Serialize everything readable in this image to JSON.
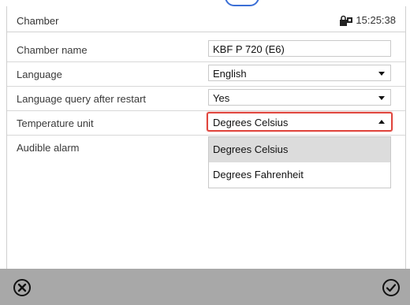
{
  "header": {
    "title": "Chamber",
    "time": "15:25:38",
    "lock_icon": "lock-icon"
  },
  "settings": [
    {
      "label": "Chamber name",
      "value": "KBF P 720 (E6)",
      "type": "text"
    },
    {
      "label": "Language",
      "value": "English",
      "type": "select"
    },
    {
      "label": "Language query after restart",
      "value": "Yes",
      "type": "select"
    },
    {
      "label": "Temperature unit",
      "value": "Degrees Celsius",
      "type": "select-open"
    },
    {
      "label": "Audible alarm",
      "value": "",
      "type": "none"
    }
  ],
  "dropdown": {
    "options": [
      "Degrees Celsius",
      "Degrees Fahrenheit"
    ],
    "selected_index": 0
  },
  "footer": {
    "cancel_icon": "cancel-icon",
    "confirm_icon": "confirm-icon"
  },
  "colors": {
    "highlight_border": "#e0473f",
    "footer_bg": "#a8a8a8",
    "selected_option_bg": "#dcdcdc"
  }
}
